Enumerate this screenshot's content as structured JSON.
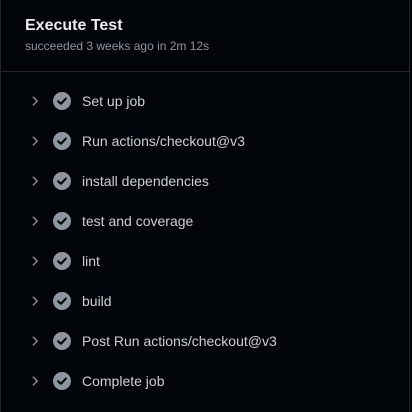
{
  "job": {
    "title": "Execute Test",
    "subtitle": "succeeded 3 weeks ago in 2m 12s"
  },
  "steps": [
    {
      "label": "Set up job",
      "status": "success",
      "icon": "check-circle-icon"
    },
    {
      "label": "Run actions/checkout@v3",
      "status": "success",
      "icon": "check-circle-icon"
    },
    {
      "label": "install dependencies",
      "status": "success",
      "icon": "check-circle-icon"
    },
    {
      "label": "test and coverage",
      "status": "success",
      "icon": "check-circle-icon"
    },
    {
      "label": "lint",
      "status": "success",
      "icon": "check-circle-icon"
    },
    {
      "label": "build",
      "status": "success",
      "icon": "check-circle-icon"
    },
    {
      "label": "Post Run actions/checkout@v3",
      "status": "success",
      "icon": "check-circle-icon"
    },
    {
      "label": "Complete job",
      "status": "success",
      "icon": "check-circle-icon"
    }
  ],
  "colors": {
    "background": "#010409",
    "title": "#e6edf3",
    "muted": "#8d96a0",
    "step_text": "#c9d1d9",
    "check_fill": "#8d96a0",
    "divider": "#21262d"
  }
}
